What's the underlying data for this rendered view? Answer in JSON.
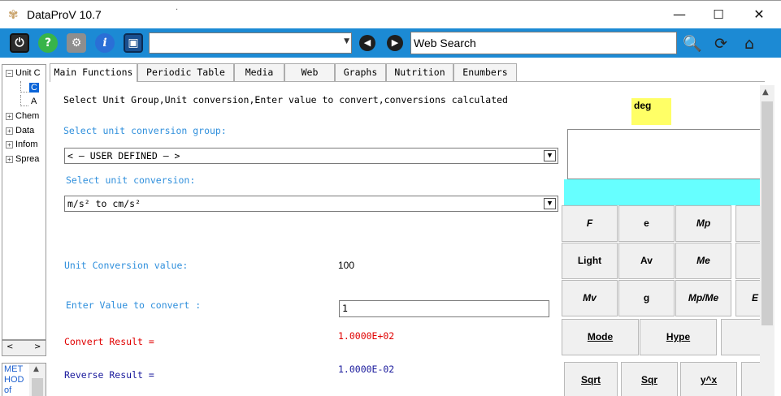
{
  "window": {
    "title": "DataProV 10.7",
    "title_dot": "·",
    "minimize": "—",
    "maximize": "☐",
    "close": "✕"
  },
  "toolbar": {
    "combo_value": "",
    "web_search": "Web Search"
  },
  "tree": {
    "items": [
      {
        "expander": "−",
        "label": "Unit C"
      },
      {
        "expander": "",
        "label": "C",
        "selected": true
      },
      {
        "expander": "",
        "label": "A"
      },
      {
        "expander": "+",
        "label": "Chem"
      },
      {
        "expander": "+",
        "label": "Data"
      },
      {
        "expander": "+",
        "label": "Infom"
      },
      {
        "expander": "+",
        "label": "Sprea"
      }
    ],
    "method_text": "MET HOD of"
  },
  "tabs": [
    "Main Functions",
    "Periodic Table",
    "Media",
    "Web",
    "Graphs",
    "Nutrition",
    "Enumbers"
  ],
  "main": {
    "instruction": "Select Unit Group,Unit conversion,Enter value to convert,conversions calculated",
    "group_label": "Select unit conversion group:",
    "group_value": "< — USER DEFINED — >",
    "conversion_label": "Select unit conversion:",
    "conversion_value": "m/s² to cm/s²",
    "ucv_label": "Unit Conversion value:",
    "ucv_value": "100",
    "enter_label": "Enter Value to convert :",
    "enter_value": "1",
    "convert_label": "Convert Result =",
    "convert_value": "1.0000E+02",
    "reverse_label": "Reverse Result =",
    "reverse_value": "1.0000E-02"
  },
  "calculator": {
    "mode": "deg",
    "row1": [
      "F",
      "e",
      "Mp"
    ],
    "row2": [
      "Light",
      "Av",
      "Me"
    ],
    "row3": [
      "Mv",
      "g",
      "Mp/Me",
      "E"
    ],
    "row4": [
      "Mode",
      "Hype"
    ],
    "row5": [
      "Sqrt",
      "Sqr",
      "y^x"
    ]
  },
  "colors": {
    "toolbar": "#1c8ad4",
    "deg_bg": "#ffff66",
    "calc_bar": "#66ffff",
    "convert_result": "#e00000",
    "reverse_result": "#1a1a9c",
    "blue_label": "#2f8fdc"
  }
}
